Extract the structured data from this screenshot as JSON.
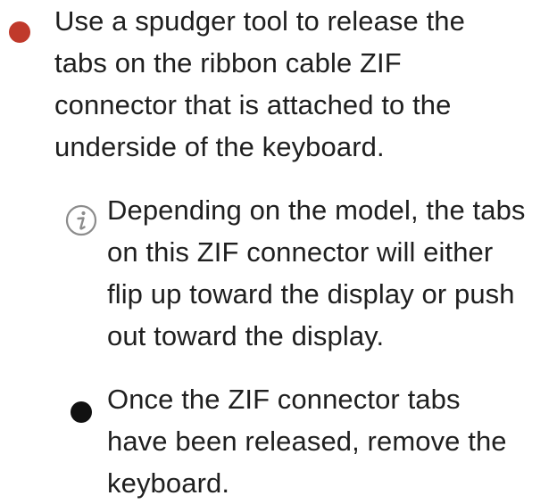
{
  "bullets": [
    {
      "color": "#c0392b",
      "lines": [
        "Use a spudger tool to release the",
        "tabs on the ribbon cable ZIF",
        "connector that is attached to the",
        "underside of the keyboard."
      ]
    },
    {
      "icon": "info-icon",
      "lines": [
        "Depending on the model, the tabs",
        "on this ZIF connector will either",
        "flip up toward the display or push",
        "out toward the display."
      ]
    },
    {
      "color": "#111111",
      "lines": [
        "Once the ZIF connector tabs",
        "have been released, remove the",
        "keyboard."
      ]
    }
  ]
}
